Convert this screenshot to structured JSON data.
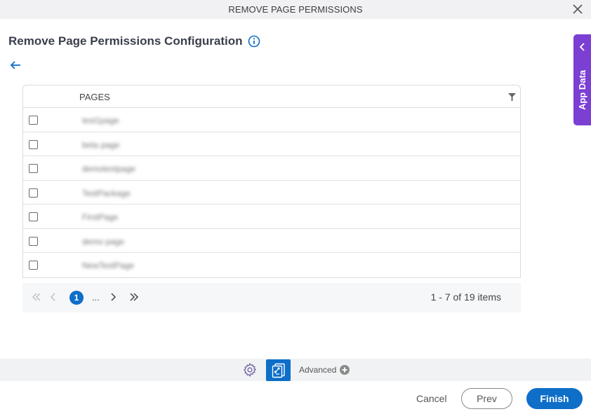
{
  "window": {
    "title": "REMOVE PAGE PERMISSIONS"
  },
  "page": {
    "heading": "Remove Page Permissions Configuration"
  },
  "side_panel": {
    "label": "App Data"
  },
  "grid": {
    "column_header": "PAGES",
    "rows": [
      {
        "name": "test1page",
        "checked": false
      },
      {
        "name": "beta page",
        "checked": false
      },
      {
        "name": "demotestpage",
        "checked": false
      },
      {
        "name": "TestPackage",
        "checked": false
      },
      {
        "name": "FirstPage",
        "checked": false
      },
      {
        "name": "demo page",
        "checked": false
      },
      {
        "name": "NewTestPage",
        "checked": false
      }
    ]
  },
  "pager": {
    "current_page": "1",
    "ellipsis": "...",
    "info": "1 - 7 of 19 items"
  },
  "toolbar": {
    "advanced_label": "Advanced"
  },
  "footer": {
    "cancel_label": "Cancel",
    "prev_label": "Prev",
    "finish_label": "Finish"
  },
  "colors": {
    "primary": "#0e6ec8",
    "side_panel": "#7c3fd4"
  }
}
